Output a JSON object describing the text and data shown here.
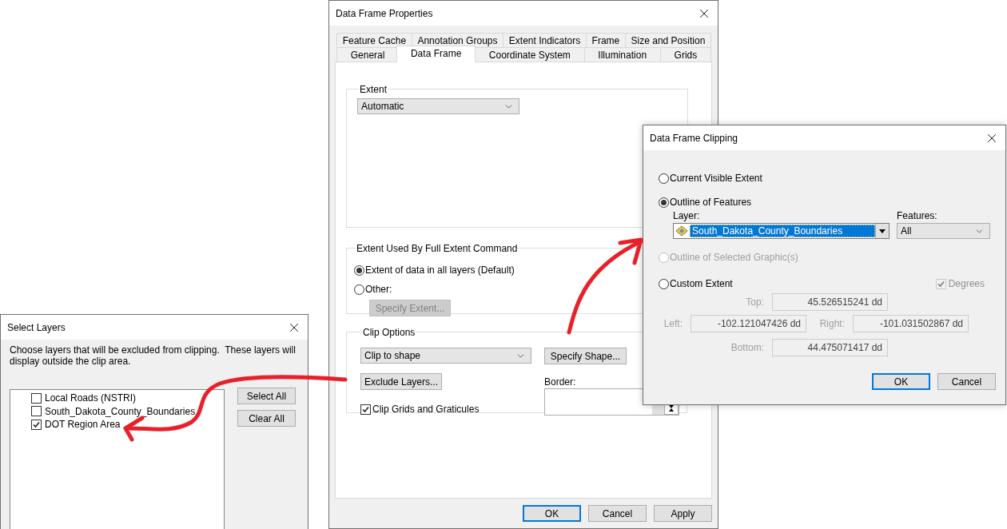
{
  "data_frame_properties": {
    "title": "Data Frame Properties",
    "tab_rows": [
      [
        {
          "label": "Feature Cache",
          "selected": false
        },
        {
          "label": "Annotation Groups",
          "selected": false
        },
        {
          "label": "Extent Indicators",
          "selected": false
        },
        {
          "label": "Frame",
          "selected": false
        },
        {
          "label": "Size and Position",
          "selected": false
        }
      ],
      [
        {
          "label": "General",
          "selected": false
        },
        {
          "label": "Data Frame",
          "selected": true
        },
        {
          "label": "Coordinate System",
          "selected": false
        },
        {
          "label": "Illumination",
          "selected": false
        },
        {
          "label": "Grids",
          "selected": false
        }
      ]
    ],
    "extent": {
      "label": "Extent",
      "value": "Automatic"
    },
    "full_extent": {
      "label": "Extent Used By Full Extent Command",
      "options": [
        {
          "label": "Extent of data in all layers (Default)",
          "selected": true
        },
        {
          "label": "Other:",
          "selected": false
        }
      ],
      "specify_button": {
        "label": "Specify Extent...",
        "disabled": true
      }
    },
    "clip_options": {
      "label": "Clip Options",
      "mode": "Clip to shape",
      "specify_shape": {
        "label": "Specify Shape...",
        "disabled": false
      },
      "exclude_layers": {
        "label": "Exclude Layers...",
        "disabled": false
      },
      "border_label": "Border:",
      "clip_grids": {
        "label": "Clip Grids and Graticules",
        "checked": true
      }
    },
    "buttons": [
      {
        "label": "OK",
        "default": true
      },
      {
        "label": "Cancel",
        "default": false
      },
      {
        "label": "Apply",
        "default": false
      }
    ]
  },
  "data_frame_clipping": {
    "title": "Data Frame Clipping",
    "current_visible_extent": {
      "label": "Current Visible Extent",
      "selected": false,
      "disabled": false
    },
    "outline_of_features": {
      "label": "Outline of Features",
      "selected": true,
      "disabled": false,
      "layer_label": "Layer:",
      "layer": "South_Dakota_County_Boundaries",
      "features_label": "Features:",
      "features": "All"
    },
    "outline_of_selected_graphics": {
      "label": "Outline of Selected Graphic(s)",
      "selected": false,
      "disabled": true
    },
    "custom_extent": {
      "label": "Custom Extent",
      "selected": false,
      "disabled": false,
      "degrees": {
        "label": "Degrees",
        "checked": true,
        "disabled": true
      },
      "top": {
        "label": "Top:",
        "value": "45.526515241 dd",
        "disabled": true
      },
      "left": {
        "label": "Left:",
        "value": "-102.121047426 dd",
        "disabled": true
      },
      "right": {
        "label": "Right:",
        "value": "-101.031502867 dd",
        "disabled": true
      },
      "bottom": {
        "label": "Bottom:",
        "value": "44.475071417 dd",
        "disabled": true
      }
    },
    "buttons": [
      {
        "label": "OK",
        "default": true
      },
      {
        "label": "Cancel",
        "default": false
      }
    ]
  },
  "select_layers": {
    "title": "Select Layers",
    "description": "Choose layers that will be excluded from clipping.  These layers will display outside the clip area.",
    "layers": [
      {
        "label": "Local Roads (NSTRI)",
        "checked": false
      },
      {
        "label": "South_Dakota_County_Boundaries",
        "checked": false
      },
      {
        "label": "DOT Region Area",
        "checked": true
      }
    ],
    "buttons": [
      "Select All",
      "Clear All"
    ]
  }
}
